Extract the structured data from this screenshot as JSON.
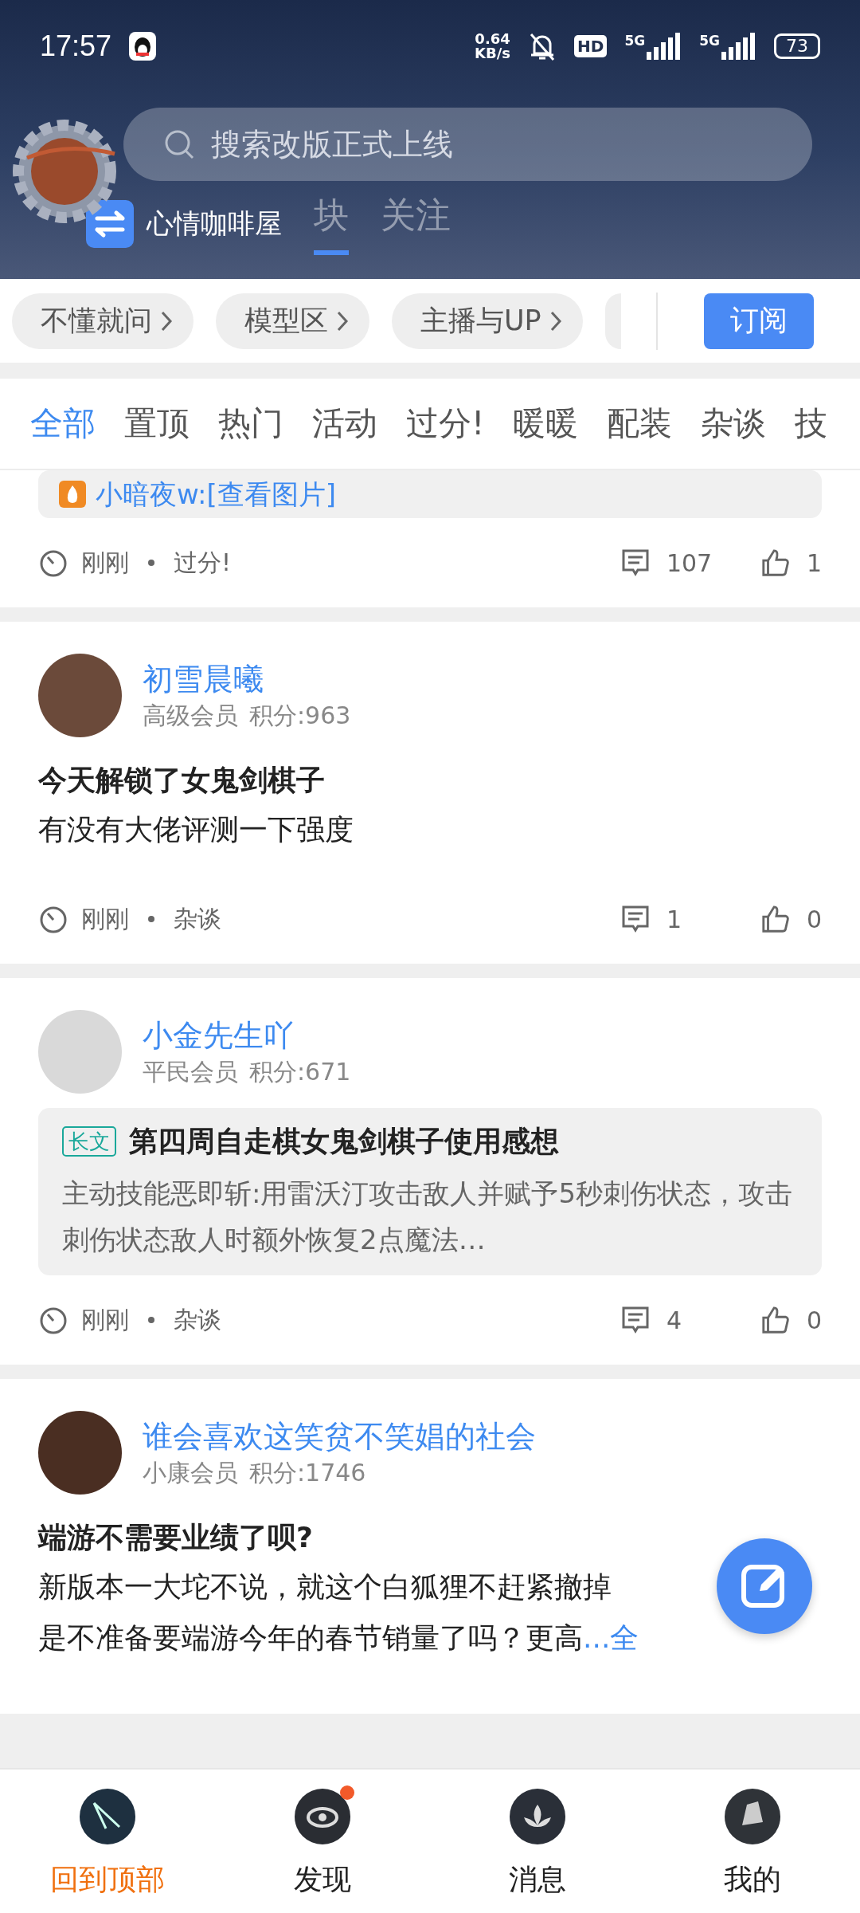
{
  "status_bar": {
    "time": "17:57",
    "speed_value": "0.64",
    "speed_unit": "KB/s",
    "hd": "HD",
    "signals": [
      {
        "label": "5G"
      },
      {
        "label": "5G"
      }
    ],
    "battery": "73"
  },
  "search": {
    "placeholder": "搜索改版正式上线"
  },
  "forum_chip": {
    "label": "心情咖啡屋"
  },
  "header_tabs": [
    {
      "label": "块",
      "selected": true
    },
    {
      "label": "关注",
      "selected": false
    }
  ],
  "categories": [
    {
      "kind": "chip",
      "label": "不懂就问"
    },
    {
      "kind": "chip",
      "label": "模型区"
    },
    {
      "kind": "chip",
      "label": "主播与UP"
    },
    {
      "kind": "cut"
    }
  ],
  "subscribe_button": "订阅",
  "filters": [
    {
      "label": "全部",
      "selected": true
    },
    {
      "label": "置顶",
      "selected": false
    },
    {
      "label": "热门",
      "selected": false
    },
    {
      "label": "活动",
      "selected": false
    },
    {
      "label": "过分!",
      "selected": false
    },
    {
      "label": "暖暖",
      "selected": false
    },
    {
      "label": "配装",
      "selected": false
    },
    {
      "label": "杂谈",
      "selected": false
    },
    {
      "label": "技",
      "selected": false
    }
  ],
  "posts": [
    {
      "kind": "partial",
      "reply": "小暗夜w:[查看图片]",
      "time": "刚刚",
      "topic": "过分!",
      "comments": "107",
      "likes": "1"
    },
    {
      "kind": "text",
      "author": "初雪晨曦",
      "rank": "高级会员",
      "points": "积分:963",
      "title": "今天解锁了女鬼剑棋子",
      "body": "有没有大佬评测一下强度",
      "time": "刚刚",
      "topic": "杂谈",
      "comments": "1",
      "likes": "0"
    },
    {
      "kind": "quote",
      "author": "小金先生吖",
      "rank": "平民会员",
      "points": "积分:671",
      "quote": {
        "tag": "长文",
        "title": "第四周自走棋女鬼剑棋子使用感想",
        "excerpt": "主动技能恶即斩:用雷沃汀攻击敌人并赋予5秒刺伤状态，攻击刺伤状态敌人时额外恢复2点魔法…"
      },
      "time": "刚刚",
      "topic": "杂谈",
      "comments": "4",
      "likes": "0"
    },
    {
      "kind": "cut",
      "author": "谁会喜欢这笑贫不笑娼的社会",
      "rank": "小康会员",
      "points": "积分:1746",
      "title": "端游不需要业绩了呗?",
      "body_lines": [
        "新版本一大坨不说，就这个白狐狸不赶紧撤掉",
        "是不准备要端游今年的春节销量了吗？更高"
      ],
      "more": "...全"
    }
  ],
  "nav": [
    {
      "label": "回到顶部",
      "selected": true,
      "badge": false
    },
    {
      "label": "发现",
      "selected": false,
      "badge": true
    },
    {
      "label": "消息",
      "selected": false,
      "badge": false
    },
    {
      "label": "我的",
      "selected": false,
      "badge": false
    }
  ]
}
